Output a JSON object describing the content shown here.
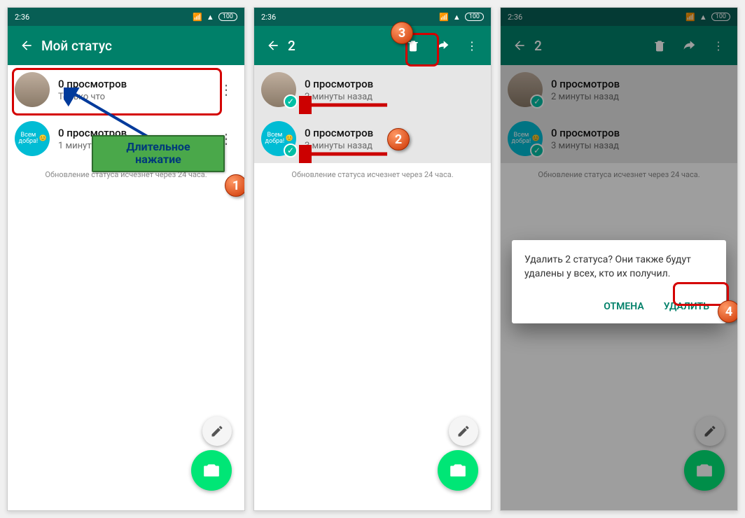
{
  "statusbar": {
    "time": "2:36",
    "battery": "100"
  },
  "screen1": {
    "title": "Мой статус",
    "items": [
      {
        "title": "0 просмотров",
        "sub": "Только что",
        "avatar_badge": "Всем добра!"
      },
      {
        "title": "0 просмотров",
        "sub": "1 минуту назад"
      }
    ],
    "note": "Обновление статуса исчезнет через 24 часа.",
    "callout": "Длительное\nнажатие"
  },
  "screen2": {
    "selection_count": "2",
    "items": [
      {
        "title": "0 просмотров",
        "sub": "2 минуты назад"
      },
      {
        "title": "0 просмотров",
        "sub": "3 минуты назад"
      }
    ],
    "note": "Обновление статуса исчезнет через 24 часа."
  },
  "screen3": {
    "selection_count": "2",
    "items": [
      {
        "title": "0 просмотров",
        "sub": "2 минуты назад"
      },
      {
        "title": "0 просмотров",
        "sub": "3 минуты назад"
      }
    ],
    "note": "Обновление статуса исчезнет через 24 часа.",
    "dialog": {
      "message": "Удалить 2 статуса? Они также будут удалены у всех, кто их получил.",
      "cancel": "ОТМЕНА",
      "delete": "УДАЛИТЬ"
    }
  },
  "avatar_text": "Всем добра!",
  "steps": {
    "1": "1",
    "2": "2",
    "3": "3",
    "4": "4"
  }
}
